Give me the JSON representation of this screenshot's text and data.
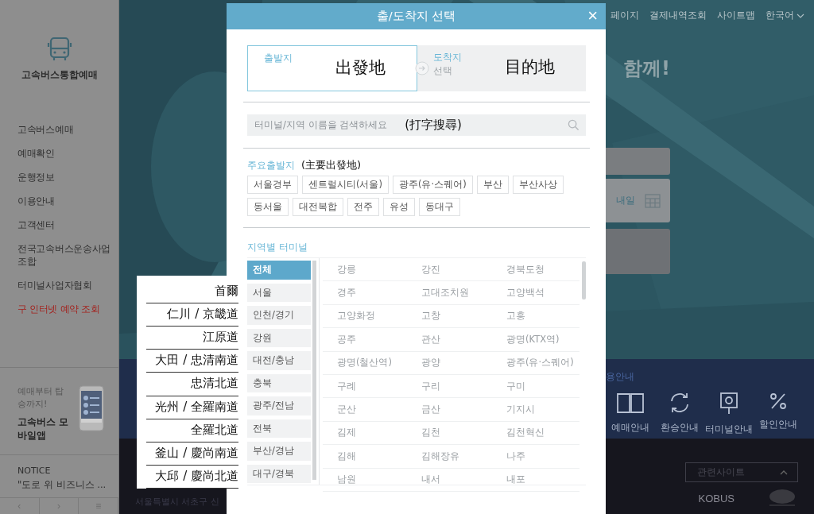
{
  "sidebar": {
    "title": "고속버스통합예매",
    "menu": [
      {
        "label": "고속버스예매",
        "highlighted": false
      },
      {
        "label": "예매확인",
        "highlighted": false
      },
      {
        "label": "운행정보",
        "highlighted": false
      },
      {
        "label": "이용안내",
        "highlighted": false
      },
      {
        "label": "고객센터",
        "highlighted": false
      },
      {
        "label": "전국고속버스운송사업조합",
        "highlighted": false
      },
      {
        "label": "터미널사업자협회",
        "highlighted": false
      },
      {
        "label": "구 인터넷 예약 조회",
        "highlighted": true
      }
    ],
    "promo": {
      "text": "예매부터 탑승까지!",
      "app": "고속버스 모바일앱"
    },
    "notice": {
      "label": "NOTICE",
      "text": "\"도로 위 비즈니스 ..."
    },
    "pager": [
      "‹",
      "›",
      "≡"
    ]
  },
  "top_nav": [
    "페이지",
    "결제내역조회",
    "사이트맵",
    "한국어"
  ],
  "hero": {
    "headline": "함께!",
    "date_value": "내일"
  },
  "guide": {
    "title": "용안내",
    "items": [
      {
        "label": "예매안내",
        "kind": "book"
      },
      {
        "label": "환승안내",
        "kind": "refresh"
      },
      {
        "label": "터미널안내",
        "kind": "pin"
      },
      {
        "label": "할인안내",
        "kind": "percent"
      }
    ]
  },
  "footer": {
    "related": "관련사이트",
    "address": "서울특별시 서초구 신",
    "logo": "KOBUS"
  },
  "modal": {
    "title": "출/도착지 선택",
    "close": "×",
    "endpoints": [
      {
        "label": "출발지",
        "annotation": "出發地",
        "selected": true
      },
      {
        "label": "도착지",
        "value": "선택",
        "annotation": "目的地",
        "selected": false
      }
    ],
    "search": {
      "placeholder": "터미널/지역 이름을 검색하세요",
      "annotation": "(打字搜尋)"
    },
    "major": {
      "title": "주요출발지",
      "annotation": "(主要出發地)",
      "chips": [
        "서울경부",
        "센트럴시티(서울)",
        "광주(유·스퀘어)",
        "부산",
        "부산사상",
        "동서울",
        "대전복합",
        "전주",
        "유성",
        "동대구"
      ]
    },
    "regional": {
      "title": "지역별 터미널",
      "regions": [
        {
          "label": "전체",
          "selected": true
        },
        {
          "label": "서울",
          "selected": false
        },
        {
          "label": "인천/경기",
          "selected": false
        },
        {
          "label": "강원",
          "selected": false
        },
        {
          "label": "대전/충남",
          "selected": false
        },
        {
          "label": "충북",
          "selected": false
        },
        {
          "label": "광주/전남",
          "selected": false
        },
        {
          "label": "전북",
          "selected": false
        },
        {
          "label": "부산/경남",
          "selected": false
        },
        {
          "label": "대구/경북",
          "selected": false
        }
      ],
      "terminals": [
        [
          "강릉",
          "강진",
          "경북도청"
        ],
        [
          "경주",
          "고대조치원",
          "고양백석"
        ],
        [
          "고양화정",
          "고창",
          "고흥"
        ],
        [
          "공주",
          "관산",
          "광명(KTX역)"
        ],
        [
          "광명(철산역)",
          "광양",
          "광주(유·스퀘어)"
        ],
        [
          "구례",
          "구리",
          "구미"
        ],
        [
          "군산",
          "금산",
          "기지시"
        ],
        [
          "김제",
          "김천",
          "김천혁신"
        ],
        [
          "김해",
          "김해장유",
          "나주"
        ],
        [
          "남원",
          "내서",
          "내포"
        ]
      ]
    }
  },
  "annotation_box": [
    "首爾",
    "仁川 / 京畿道",
    "江原道",
    "大田 / 忠清南道",
    "忠清北道",
    "光州 / 全羅南道",
    "全羅北道",
    "釜山 / 慶尚南道",
    "大邱 / 慶尚北道"
  ]
}
